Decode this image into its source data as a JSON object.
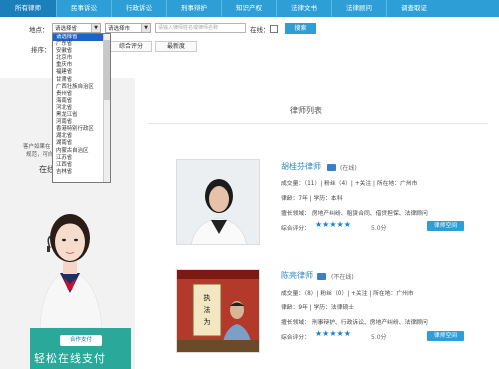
{
  "nav": {
    "tabs": [
      "所有律师",
      "民事诉讼",
      "行政诉讼",
      "刑事辩护",
      "知识产权",
      "法律文书",
      "法律顾问",
      "调查取证"
    ]
  },
  "filter": {
    "area_label": "地点：",
    "province_value": "请选择省",
    "city_value": "请选择市",
    "search_placeholder": "请输入律师姓名或律师名称",
    "online_label": "在线：",
    "search_button": "搜索",
    "sort_label": "排序：",
    "sort_buttons": [
      "综合评分",
      "最新度"
    ]
  },
  "province_dropdown": {
    "items": [
      "请选择省",
      "广东省",
      "安徽省",
      "北京市",
      "重庆市",
      "福建省",
      "甘肃省",
      "广西壮族自治区",
      "贵州省",
      "海南省",
      "河北省",
      "黑龙江省",
      "河南省",
      "香港特别行政区",
      "湖北省",
      "湖南省",
      "内蒙古自治区",
      "江苏省",
      "江西省",
      "吉林省"
    ],
    "selected_index": 0
  },
  "left": {
    "line1": "客户如果在",
    "line2": "规范，可向",
    "online_text": "在线"
  },
  "banner": {
    "logo_text": "合作支付",
    "text": "轻松在线支付"
  },
  "main": {
    "title": "律师列表",
    "lawyers": [
      {
        "name": "胡桂芬律师",
        "status": "(在线)",
        "stats": "成交量：（11）| 粉丝（4）| +关注 | 所在地：广州市",
        "line2": "律龄：7年 | 学历：本科",
        "fields": "擅长领域：  房地产纠纷、租赁合同、借贷担保、法律顾问",
        "rating_label": "综合评分：",
        "stars": "★★★★★",
        "score": "5.0分",
        "space_button": "律师空间"
      },
      {
        "name": "陈亮律师",
        "status": "(不在线)",
        "stats": "成交量：（8）| 粉丝（0）| +关注 | 所在地：广州市",
        "line2": "律龄：9年 | 学历：法律硕士",
        "fields": "擅长领域：  刑事辩护、行政诉讼、房地产纠纷、法律顾问",
        "rating_label": "综合评分：",
        "stars": "★★★★★",
        "score": "5.0分",
        "space_button": "律师空间"
      }
    ]
  },
  "colors": {
    "accent": "#2e9fd6",
    "tab_active": "#1b7fbb",
    "link": "#2e86c1"
  }
}
